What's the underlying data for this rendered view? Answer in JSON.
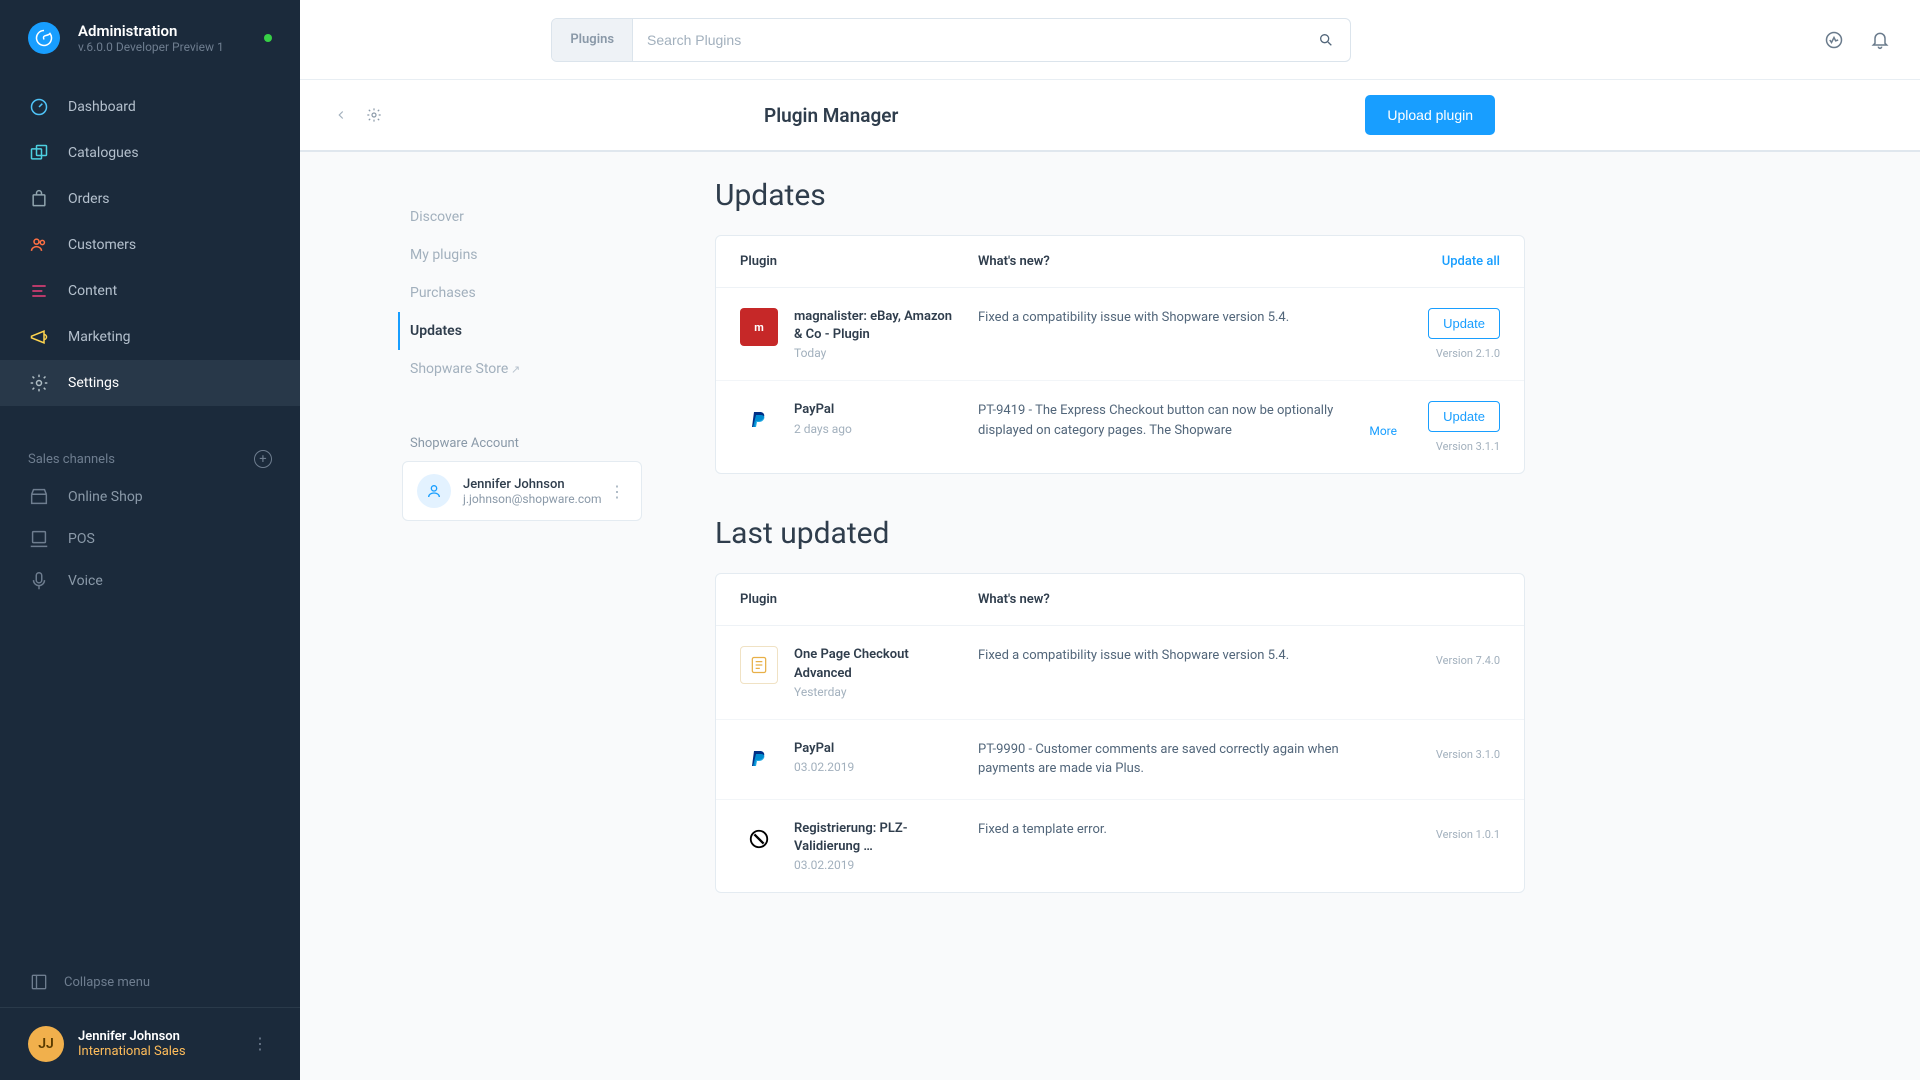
{
  "app": {
    "title": "Administration",
    "version": "v.6.0.0 Developer Preview 1"
  },
  "nav": [
    {
      "label": "Dashboard"
    },
    {
      "label": "Catalogues"
    },
    {
      "label": "Orders"
    },
    {
      "label": "Customers"
    },
    {
      "label": "Content"
    },
    {
      "label": "Marketing"
    },
    {
      "label": "Settings"
    }
  ],
  "channels_header": "Sales channels",
  "channels": [
    {
      "label": "Online Shop"
    },
    {
      "label": "POS"
    },
    {
      "label": "Voice"
    }
  ],
  "collapse_label": "Collapse menu",
  "user": {
    "name": "Jennifer Johnson",
    "role": "International Sales",
    "initials": "JJ"
  },
  "search": {
    "scope": "Plugins",
    "placeholder": "Search Plugins"
  },
  "page_title": "Plugin Manager",
  "upload_label": "Upload plugin",
  "subnav": [
    {
      "label": "Discover"
    },
    {
      "label": "My plugins"
    },
    {
      "label": "Purchases"
    },
    {
      "label": "Updates"
    },
    {
      "label": "Shopware Store"
    }
  ],
  "account": {
    "heading": "Shopware Account",
    "name": "Jennifer Johnson",
    "email": "j.johnson@shopware.com"
  },
  "sections": {
    "updates": {
      "title": "Updates",
      "col_plugin": "Plugin",
      "col_news": "What's new?",
      "update_all": "Update all"
    },
    "last": {
      "title": "Last updated",
      "col_plugin": "Plugin",
      "col_news": "What's new?"
    }
  },
  "updates": [
    {
      "name": "magnalister: eBay, Amazon & Co - Plugin",
      "date": "Today",
      "news": "Fixed a compatibility issue with Shopware version 5.4.",
      "btn": "Update",
      "version": "Version 2.1.0"
    },
    {
      "name": "PayPal",
      "date": "2 days ago",
      "news": "PT-9419 - The Express Checkout button can now be optionally displayed on category pages. The Shopware",
      "btn": "Update",
      "version": "Version 3.1.1",
      "more": "More"
    }
  ],
  "last_updated": [
    {
      "name": "One Page Checkout Advanced",
      "date": "Yesterday",
      "news": "Fixed a compatibility issue with Shopware version 5.4.",
      "version": "Version 7.4.0"
    },
    {
      "name": "PayPal",
      "date": "03.02.2019",
      "news": "PT-9990 - Customer comments are saved correctly again when payments are made via Plus.",
      "version": "Version 3.1.0"
    },
    {
      "name": "Registrierung: PLZ-Validierung …",
      "date": "03.02.2019",
      "news": "Fixed a template error.",
      "version": "Version 1.0.1"
    }
  ]
}
